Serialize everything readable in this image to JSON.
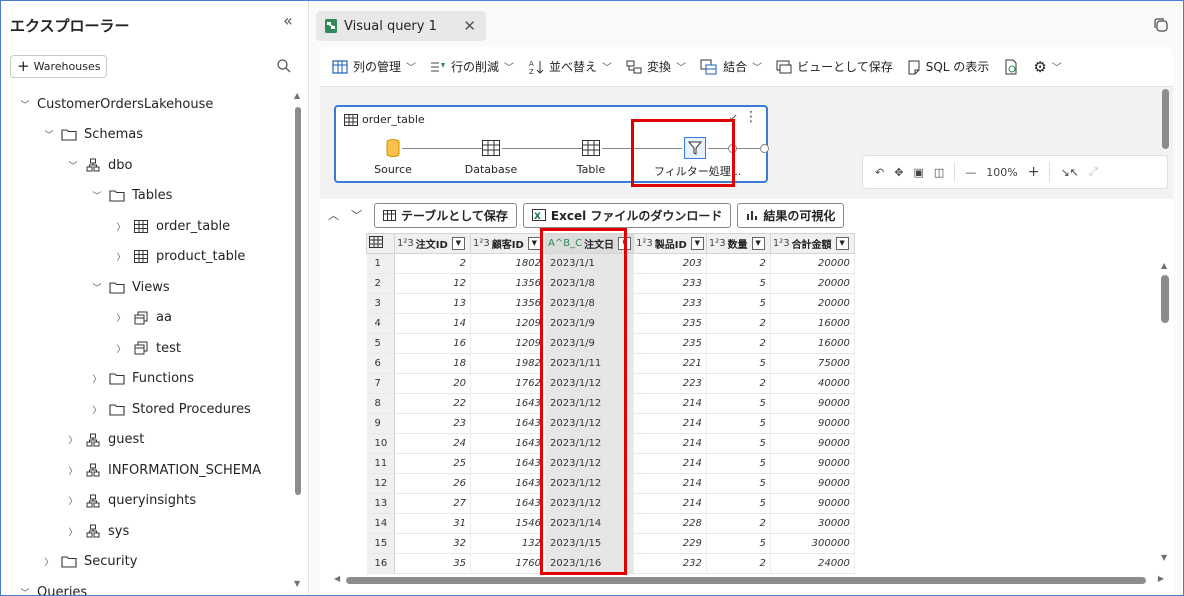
{
  "explorer": {
    "title": "エクスプローラー",
    "warehouses_button": "Warehouses",
    "tree": [
      {
        "label": "CustomerOrdersLakehouse",
        "icon": "none",
        "chev": "down"
      },
      {
        "label": "Schemas",
        "icon": "folder-icon",
        "chev": "down"
      },
      {
        "label": "dbo",
        "icon": "schema-icon",
        "chev": "down"
      },
      {
        "label": "Tables",
        "icon": "folder-icon",
        "chev": "down"
      },
      {
        "label": "order_table",
        "icon": "table-icon",
        "chev": "right"
      },
      {
        "label": "product_table",
        "icon": "table-icon",
        "chev": "right"
      },
      {
        "label": "Views",
        "icon": "folder-icon",
        "chev": "down"
      },
      {
        "label": "aa",
        "icon": "view-icon",
        "chev": "right"
      },
      {
        "label": "test",
        "icon": "view-icon",
        "chev": "right"
      },
      {
        "label": "Functions",
        "icon": "folder-icon",
        "chev": "right"
      },
      {
        "label": "Stored Procedures",
        "icon": "folder-icon",
        "chev": "right"
      },
      {
        "label": "guest",
        "icon": "schema-icon",
        "chev": "right"
      },
      {
        "label": "INFORMATION_SCHEMA",
        "icon": "schema-icon",
        "chev": "right"
      },
      {
        "label": "queryinsights",
        "icon": "schema-icon",
        "chev": "right"
      },
      {
        "label": "sys",
        "icon": "schema-icon",
        "chev": "right"
      },
      {
        "label": "Security",
        "icon": "folder-icon",
        "chev": "right"
      },
      {
        "label": "Queries",
        "icon": "none",
        "chev": "down"
      }
    ]
  },
  "tab": {
    "label": "Visual query 1"
  },
  "ribbon": {
    "manage_columns": "列の管理",
    "remove_rows": "行の削減",
    "sort": "並べ替え",
    "transform": "変換",
    "combine": "結合",
    "save_as_view": "ビューとして保存",
    "show_sql": "SQL の表示"
  },
  "diagram": {
    "card_title": "order_table",
    "steps": [
      {
        "label": "Source",
        "icon": "database-cylinder-icon"
      },
      {
        "label": "Database",
        "icon": "table-icon"
      },
      {
        "label": "Table",
        "icon": "table-icon"
      },
      {
        "label": "フィルター処理...",
        "icon": "filter-icon"
      }
    ],
    "zoom": "100%"
  },
  "results": {
    "save_as_table": "テーブルとして保存",
    "download_excel": "Excel ファイルのダウンロード",
    "visualize": "結果の可視化"
  },
  "grid": {
    "columns": [
      {
        "type": "1²3",
        "name": "注文ID"
      },
      {
        "type": "1²3",
        "name": "顧客ID"
      },
      {
        "type": "A^B_C",
        "name": "注文日"
      },
      {
        "type": "1²3",
        "name": "製品ID"
      },
      {
        "type": "1²3",
        "name": "数量"
      },
      {
        "type": "1²3",
        "name": "合計金額"
      }
    ],
    "rows": [
      [
        "1",
        "2",
        "1802",
        "2023/1/1",
        "203",
        "2",
        "20000"
      ],
      [
        "2",
        "12",
        "1356",
        "2023/1/8",
        "233",
        "5",
        "20000"
      ],
      [
        "3",
        "13",
        "1356",
        "2023/1/8",
        "233",
        "5",
        "20000"
      ],
      [
        "4",
        "14",
        "1209",
        "2023/1/9",
        "235",
        "2",
        "16000"
      ],
      [
        "5",
        "16",
        "1209",
        "2023/1/9",
        "235",
        "2",
        "16000"
      ],
      [
        "6",
        "18",
        "1982",
        "2023/1/11",
        "221",
        "5",
        "75000"
      ],
      [
        "7",
        "20",
        "1762",
        "2023/1/12",
        "223",
        "2",
        "40000"
      ],
      [
        "8",
        "22",
        "1643",
        "2023/1/12",
        "214",
        "5",
        "90000"
      ],
      [
        "9",
        "23",
        "1643",
        "2023/1/12",
        "214",
        "5",
        "90000"
      ],
      [
        "10",
        "24",
        "1643",
        "2023/1/12",
        "214",
        "5",
        "90000"
      ],
      [
        "11",
        "25",
        "1643",
        "2023/1/12",
        "214",
        "5",
        "90000"
      ],
      [
        "12",
        "26",
        "1643",
        "2023/1/12",
        "214",
        "5",
        "90000"
      ],
      [
        "13",
        "27",
        "1643",
        "2023/1/12",
        "214",
        "5",
        "90000"
      ],
      [
        "14",
        "31",
        "1546",
        "2023/1/14",
        "228",
        "2",
        "30000"
      ],
      [
        "15",
        "32",
        "132",
        "2023/1/15",
        "229",
        "5",
        "300000"
      ],
      [
        "16",
        "35",
        "1760",
        "2023/1/16",
        "232",
        "2",
        "24000"
      ]
    ]
  },
  "colors": {
    "accent": "#3a7bd5",
    "highlight": "#e00000",
    "source_icon": "#f0a30a"
  }
}
